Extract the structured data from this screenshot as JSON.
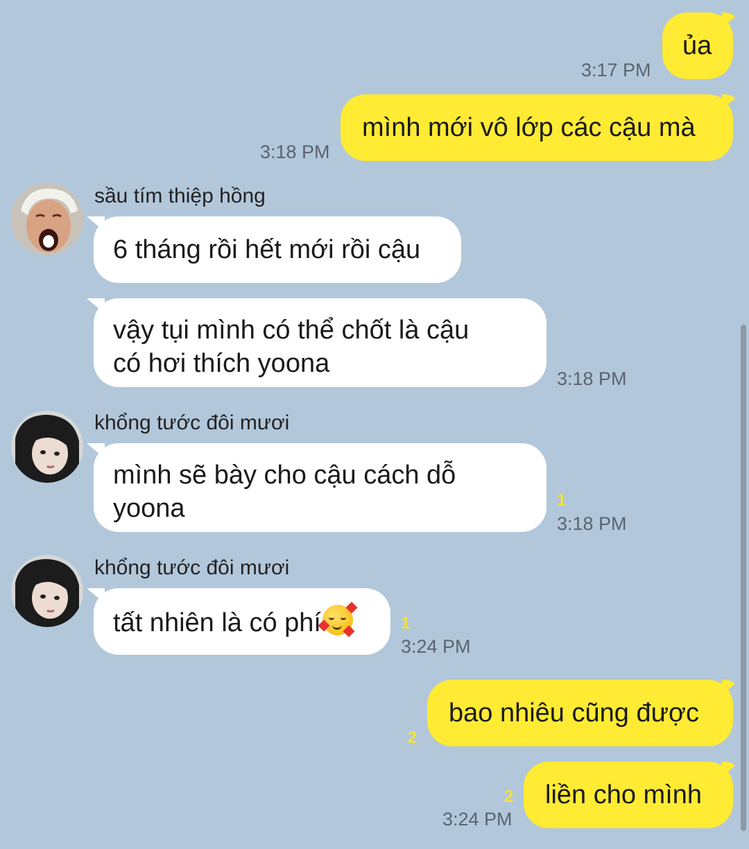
{
  "messages": {
    "m1": {
      "text": "ủa",
      "time": "3:17 PM"
    },
    "m2": {
      "text": "mình mới vô lớp các cậu mà",
      "time": "3:18 PM"
    },
    "g1": {
      "sender": "sầu tím thiệp hồng",
      "b1": "6 tháng rồi hết mới rồi cậu",
      "b2_line1": "vậy tụi mình có thể chốt là cậu",
      "b2_line2": "có hơi thích yoona",
      "time": "3:18 PM"
    },
    "g2": {
      "sender": "khổng tước đôi mươi",
      "line1": "mình sẽ bày cho cậu cách dỗ",
      "line2": "yoona",
      "unread": "1",
      "time": "3:18 PM"
    },
    "g3": {
      "sender": "khổng tước đôi mươi",
      "text": "tất nhiên là có phí",
      "emoji": "smiling-face-with-hearts",
      "unread": "1",
      "time": "3:24 PM"
    },
    "m3": {
      "text": "bao nhiêu cũng được",
      "unread": "2"
    },
    "m4": {
      "text": "liền cho mình",
      "unread": "2",
      "time": "3:24 PM"
    }
  },
  "colors": {
    "background": "#b2c7da",
    "my_bubble": "#ffeb33",
    "their_bubble": "#ffffff",
    "unread": "#f5e23a"
  }
}
